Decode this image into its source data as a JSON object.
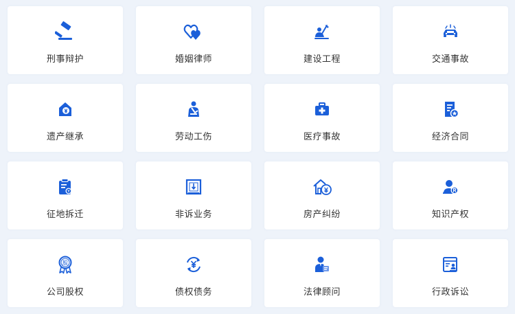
{
  "accent_color": "#1b5fd9",
  "categories": [
    {
      "label": "刑事辩护",
      "icon": "gavel-icon"
    },
    {
      "label": "婚姻律师",
      "icon": "hearts-icon"
    },
    {
      "label": "建设工程",
      "icon": "construction-worker-icon"
    },
    {
      "label": "交通事故",
      "icon": "car-accident-icon"
    },
    {
      "label": "遗产继承",
      "icon": "house-yen-icon"
    },
    {
      "label": "劳动工伤",
      "icon": "injured-worker-icon"
    },
    {
      "label": "医疗事故",
      "icon": "medical-kit-icon"
    },
    {
      "label": "经济合同",
      "icon": "contract-document-icon"
    },
    {
      "label": "征地拆迁",
      "icon": "clipboard-relocation-icon"
    },
    {
      "label": "非诉业务",
      "icon": "framed-document-icon"
    },
    {
      "label": "房产纠纷",
      "icon": "house-dispute-icon"
    },
    {
      "label": "知识产权",
      "icon": "registered-trademark-icon"
    },
    {
      "label": "公司股权",
      "icon": "equity-rosette-icon"
    },
    {
      "label": "债权债务",
      "icon": "debt-exchange-icon"
    },
    {
      "label": "法律顾问",
      "icon": "legal-advisor-icon"
    },
    {
      "label": "行政诉讼",
      "icon": "administrative-form-icon"
    }
  ]
}
